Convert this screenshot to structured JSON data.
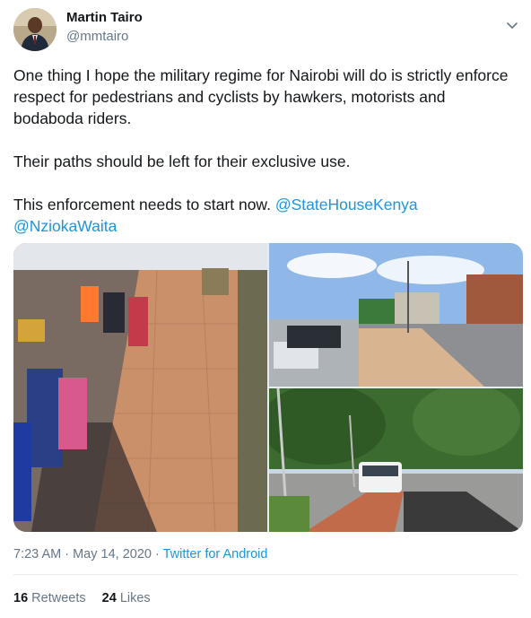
{
  "author": {
    "display_name": "Martin Tairo",
    "handle": "@mmtairo"
  },
  "tweet": {
    "paragraphs": [
      "One thing I hope the military regime for Nairobi will do is strictly enforce respect for pedestrians and cyclists by hawkers, motorists and bodaboda riders.",
      "Their paths should be left for their exclusive use."
    ],
    "last_paragraph_text": "This enforcement needs to start now. ",
    "mentions": [
      "@StateHouseKenya",
      "@NziokaWaita"
    ]
  },
  "media": {
    "photos": [
      {
        "description": "brick-paved pedestrian walkway with hawker suitcases and people sitting on the left"
      },
      {
        "description": "pedestrian walkway beside a road with parked cars and buildings under blue sky"
      },
      {
        "description": "newly paved walkway and road with a white van and trees"
      }
    ]
  },
  "meta": {
    "time": "7:23 AM",
    "separator1": " · ",
    "date": "May 14, 2020",
    "separator2": " · ",
    "source": "Twitter for Android"
  },
  "stats": {
    "retweets_count": "16",
    "retweets_label": "Retweets",
    "likes_count": "24",
    "likes_label": "Likes"
  },
  "icons": {
    "menu": "chevron-down-icon"
  },
  "colors": {
    "link": "#1b95e0",
    "secondary_text": "#657786",
    "primary_text": "#14171a"
  }
}
